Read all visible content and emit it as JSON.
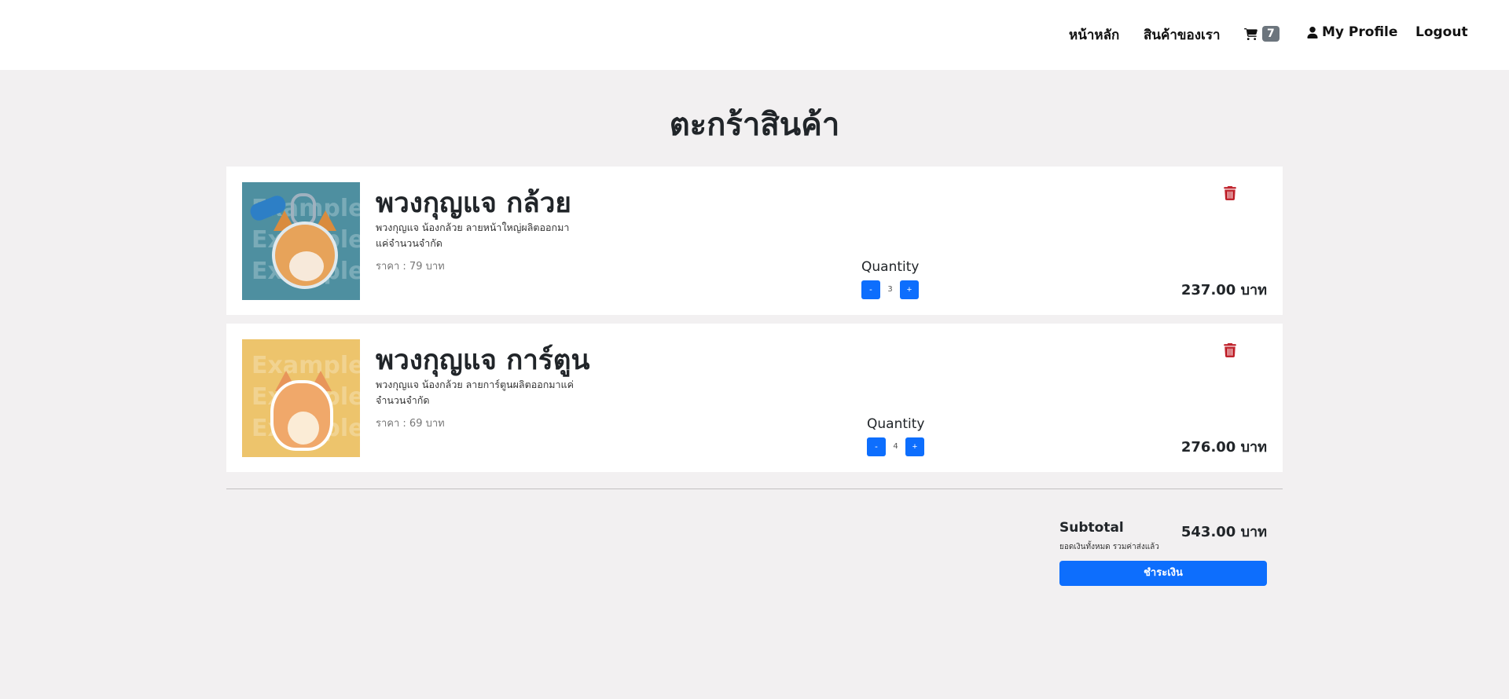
{
  "nav": {
    "home": "หน้าหลัก",
    "products": "สินค้าของเรา",
    "cart_icon": "cart-icon",
    "cart_count": "7",
    "profile_icon": "user-icon",
    "profile": "My Profile",
    "logout": "Logout"
  },
  "page": {
    "title": "ตะกร้าสินค้า"
  },
  "items": [
    {
      "title": "พวงกุญแจ กล้วย",
      "description": "พวงกุญแจ น้องกล้วย ลายหน้าใหญ่ผลิตออกมาแค่จำนวนจำกัด",
      "price": "ราคา : 79 บาท",
      "quantity_label": "Quantity",
      "quantity": "3",
      "minus": "-",
      "plus": "+",
      "total": "237.00 บาท",
      "watermark": [
        "Example",
        "Example",
        "Example"
      ]
    },
    {
      "title": "พวงกุญแจ การ์ตูน",
      "description": "พวงกุญแจ น้องกล้วย ลายการ์ตูนผลิตออกมาแค่จำนวนจำกัด",
      "price": "ราคา : 69 บาท",
      "quantity_label": "Quantity",
      "quantity": "4",
      "minus": "-",
      "plus": "+",
      "total": "276.00 บาท",
      "watermark": [
        "Example",
        "Example",
        "Example"
      ]
    }
  ],
  "summary": {
    "subtotal_label": "Subtotal",
    "subtotal_value": "543.00 บาท",
    "note": "ยอดเงินทั้งหมด รวมค่าส่งแล้ว",
    "checkout": "ชำระเงิน"
  },
  "colors": {
    "primary": "#0d6efd",
    "danger": "#c0252e",
    "background": "#f2f0f1",
    "badge": "#6c757d"
  }
}
